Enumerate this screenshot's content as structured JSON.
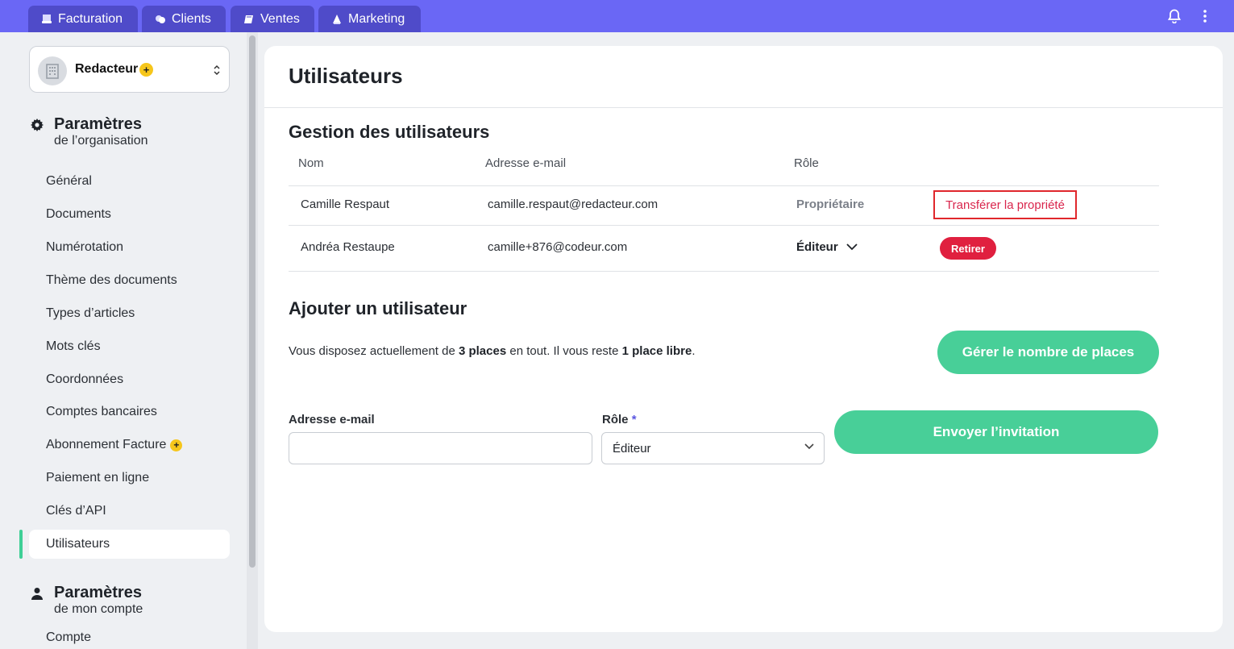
{
  "topbar": {
    "tabs": [
      {
        "label": "Facturation",
        "icon": "invoice-icon"
      },
      {
        "label": "Clients",
        "icon": "clients-icon"
      },
      {
        "label": "Ventes",
        "icon": "sales-icon"
      },
      {
        "label": "Marketing",
        "icon": "marketing-icon"
      }
    ],
    "icons": [
      "bell-icon",
      "more-vertical-icon"
    ],
    "bg_color": "#6a67f5",
    "tab_color": "#4f4bc9"
  },
  "sidebar": {
    "org": {
      "name": "Redacteur",
      "badge": "+"
    },
    "org_settings": {
      "title": "Paramètres",
      "subtitle": "de l’organisation"
    },
    "items": [
      {
        "label": "Général"
      },
      {
        "label": "Documents"
      },
      {
        "label": "Numérotation"
      },
      {
        "label": "Thème des documents"
      },
      {
        "label": "Types d’articles"
      },
      {
        "label": "Mots clés"
      },
      {
        "label": "Coordonnées"
      },
      {
        "label": "Comptes bancaires"
      },
      {
        "label": "Abonnement Facture",
        "badge": "+"
      },
      {
        "label": "Paiement en ligne"
      },
      {
        "label": "Clés d’API"
      },
      {
        "label": "Utilisateurs",
        "active": true
      }
    ],
    "account_settings": {
      "title": "Paramètres",
      "subtitle": "de mon compte"
    },
    "account_items": [
      {
        "label": "Compte"
      }
    ],
    "accent_color": "#3ecf96"
  },
  "main": {
    "page_title": "Utilisateurs",
    "users_section": {
      "title": "Gestion des utilisateurs",
      "columns": [
        "Nom",
        "Adresse e-mail",
        "Rôle"
      ],
      "rows": [
        {
          "name": "Camille Respaut",
          "email": "camille.respaut@redacteur.com",
          "role": "Propriétaire",
          "action": "Transférer la propriété"
        },
        {
          "name": "Andréa Restaupe",
          "email": "camille+876@codeur.com",
          "role": "Éditeur",
          "action": "Retirer"
        }
      ]
    },
    "add_section": {
      "title": "Ajouter un utilisateur",
      "info": {
        "prefix": "Vous disposez actuellement de ",
        "total": "3 places",
        "middle": " en tout. Il vous reste ",
        "free": "1 place libre",
        "suffix": "."
      },
      "manage_button": "Gérer le nombre de places",
      "email_label": "Adresse e-mail",
      "email_value": "",
      "role_label": "Rôle",
      "required_mark": "*",
      "role_value": "Éditeur",
      "invite_button": "Envoyer l’invitation"
    },
    "colors": {
      "primary_green": "#48cf98",
      "danger": "#e0203f",
      "link_red": "#d9264d"
    }
  }
}
